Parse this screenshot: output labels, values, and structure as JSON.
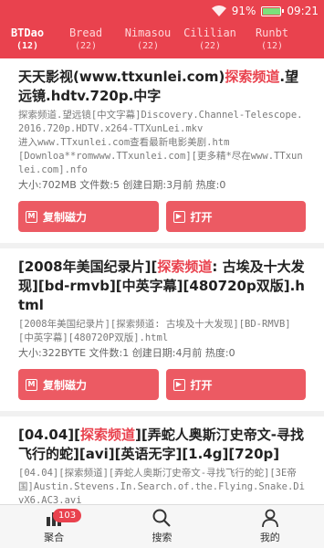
{
  "status": {
    "battery": "91%",
    "time": "09:21",
    "battery_level": 0.91
  },
  "tabs": [
    {
      "name": "BTDao",
      "count": "(12)",
      "active": true
    },
    {
      "name": "Bread",
      "count": "(22)",
      "active": false
    },
    {
      "name": "Nimasou",
      "count": "(22)",
      "active": false
    },
    {
      "name": "Cililian",
      "count": "(22)",
      "active": false
    },
    {
      "name": "Runbt",
      "count": "(12)",
      "active": false
    }
  ],
  "items": [
    {
      "title_pre": "天天影视(www.ttxunlei.com)",
      "title_hl": "探索频道",
      "title_post": ".望远镜.hdtv.720p.中字",
      "desc": "探索频道.望远镜[中文字幕]Discovery.Channel-Telescope.2016.720p.HDTV.x264-TTXunLei.mkv\n进入www.TTxunlei.com查看最新电影美剧.htm\n[Downloa**romwww.TTxunlei.com][更多精*尽在www.TTxunlei.com].nfo",
      "meta": "大小:702MB  文件数:5  创建日期:3月前  热度:0"
    },
    {
      "title_pre": "[2008年美国纪录片][",
      "title_hl": "探索频道",
      "title_post": ": 古埃及十大发现][bd-rmvb][中英字幕][480720p双版].html",
      "desc": "[2008年美国纪录片][探索频道: 古埃及十大发现][BD-RMVB][中英字幕][480720P双版].html",
      "meta": "大小:322BYTE  文件数:1  创建日期:4月前  热度:0"
    },
    {
      "title_pre": "[04.04][",
      "title_hl": "探索频道",
      "title_post": "][弄蛇人奥斯汀史帝文-寻找飞行的蛇][avi][英语无字][1.4g][720p]",
      "desc": "[04.04][探索频道][弄蛇人奥斯汀史帝文-寻找飞行的蛇][3E帝国]Austin.Stevens.In.Search.of.the.Flying.Snake.DivX6.AC3.avi",
      "meta": ""
    }
  ],
  "actions": {
    "copy_label": "复制磁力",
    "open_label": "打开"
  },
  "bottom_nav": [
    {
      "label": "聚合",
      "badge": "103",
      "icon": "bar-chart-icon"
    },
    {
      "label": "搜索",
      "badge": "",
      "icon": "search-icon"
    },
    {
      "label": "我的",
      "badge": "",
      "icon": "user-icon"
    }
  ]
}
